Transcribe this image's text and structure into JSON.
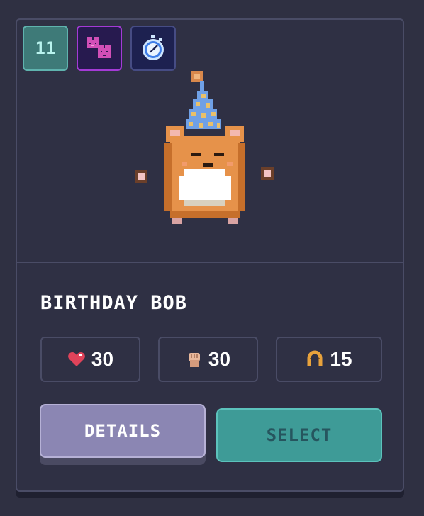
{
  "badges": {
    "level": "11",
    "pets_icon": "pet-group-icon",
    "timer_icon": "stopwatch-icon"
  },
  "character": {
    "name": "BIRTHDAY BOB",
    "sprite": "hamster-party-hat"
  },
  "stats": [
    {
      "icon": "heart-icon",
      "value": "30"
    },
    {
      "icon": "fist-icon",
      "value": "30"
    },
    {
      "icon": "horseshoe-icon",
      "value": "15"
    }
  ],
  "buttons": {
    "details": "DETAILS",
    "select": "SELECT"
  },
  "colors": {
    "background": "#2f3042",
    "border": "#4a4c66",
    "level_badge": "#3e7a78",
    "details_button": "#8b86b3",
    "select_button": "#3e9b97"
  }
}
